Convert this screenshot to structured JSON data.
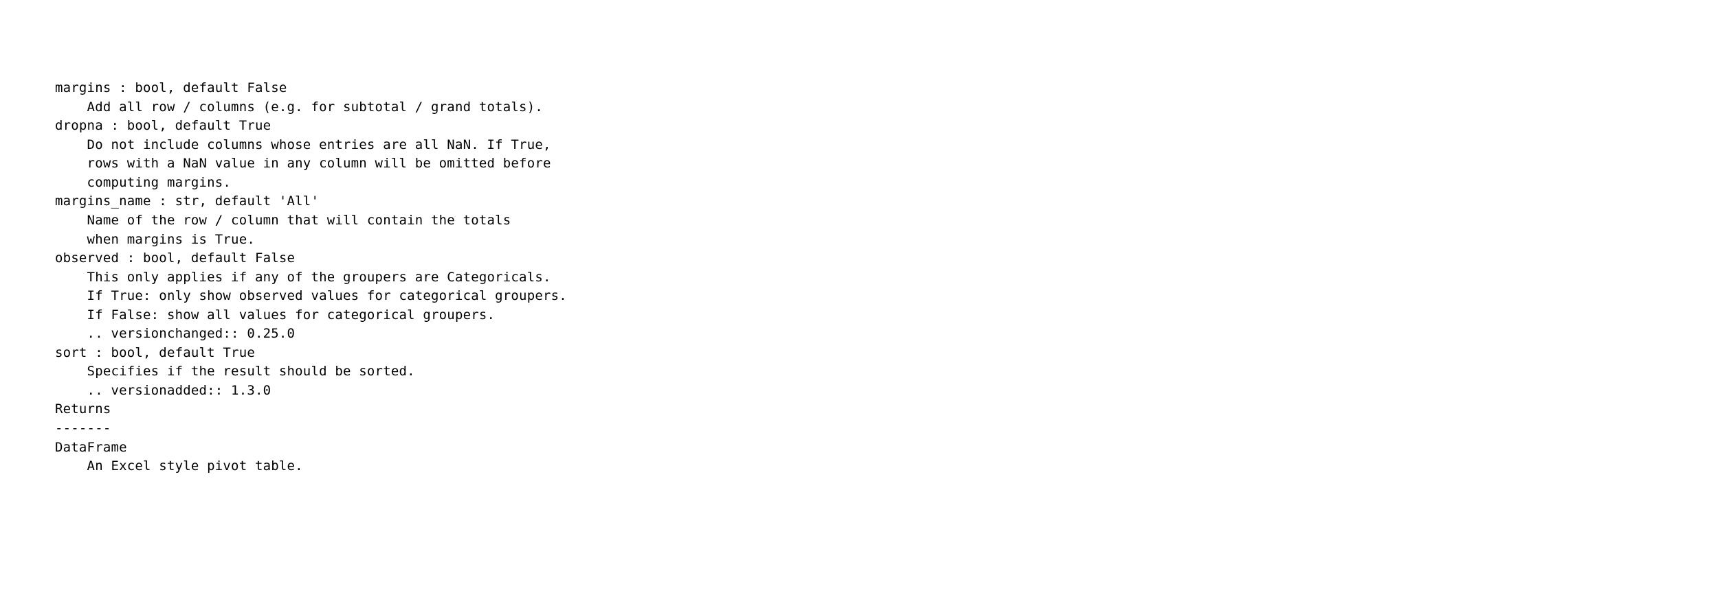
{
  "docstring": {
    "lines": [
      "margins : bool, default False",
      "    Add all row / columns (e.g. for subtotal / grand totals).",
      "dropna : bool, default True",
      "    Do not include columns whose entries are all NaN. If True,",
      "    rows with a NaN value in any column will be omitted before",
      "    computing margins.",
      "margins_name : str, default 'All'",
      "    Name of the row / column that will contain the totals",
      "    when margins is True.",
      "observed : bool, default False",
      "    This only applies if any of the groupers are Categoricals.",
      "    If True: only show observed values for categorical groupers.",
      "    If False: show all values for categorical groupers.",
      "",
      "    .. versionchanged:: 0.25.0",
      "",
      "sort : bool, default True",
      "    Specifies if the result should be sorted.",
      "",
      "    .. versionadded:: 1.3.0",
      "",
      "Returns",
      "-------",
      "DataFrame",
      "    An Excel style pivot table."
    ]
  }
}
